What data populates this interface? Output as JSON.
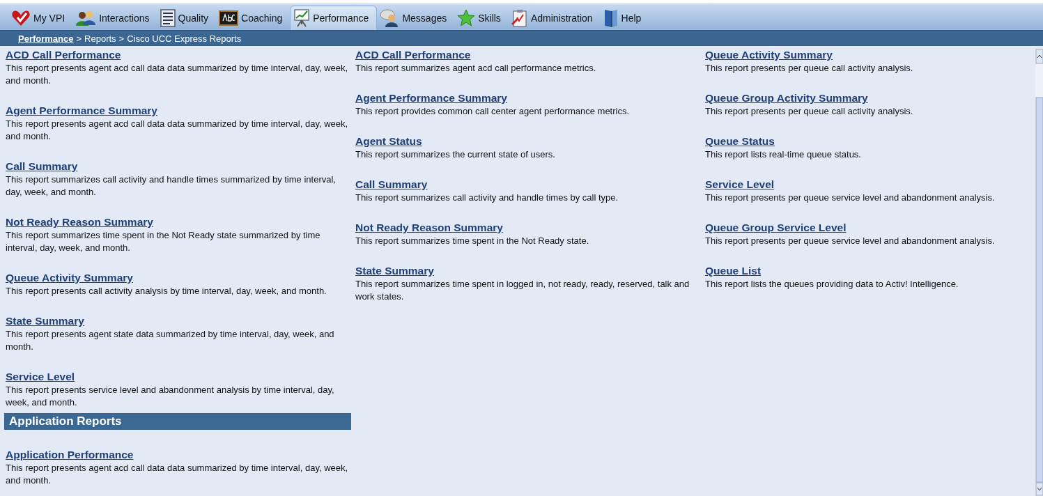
{
  "tabs": [
    {
      "label": "My VPI",
      "selected": false
    },
    {
      "label": "Interactions",
      "selected": false
    },
    {
      "label": "Quality",
      "selected": false
    },
    {
      "label": "Coaching",
      "selected": false
    },
    {
      "label": "Performance",
      "selected": true
    },
    {
      "label": "Messages",
      "selected": false
    },
    {
      "label": "Skills",
      "selected": false
    },
    {
      "label": "Administration",
      "selected": false
    },
    {
      "label": "Help",
      "selected": false
    }
  ],
  "breadcrumb": [
    {
      "kind": "link",
      "label": "Performance"
    },
    {
      "kind": "separator",
      "label": ">"
    },
    {
      "kind": "text",
      "label": "Reports"
    },
    {
      "kind": "separator",
      "label": ">"
    },
    {
      "kind": "text",
      "label": "Cisco UCC Express Reports"
    }
  ],
  "columns": [
    {
      "sections": [
        {
          "reports": [
            {
              "title": "ACD Call Performance",
              "description": "This report presents agent acd call data data summarized by time interval, day, week, and month."
            },
            {
              "title": "Agent Performance Summary",
              "description": "This report presents agent acd call data data summarized by time interval, day, week, and month."
            },
            {
              "title": "Call Summary",
              "description": "This report summarizes call activity and handle times summarized by time interval, day, week, and month."
            },
            {
              "title": "Not Ready Reason Summary",
              "description": "This report summarizes time spent in the Not Ready state summarized by time interval, day, week, and month."
            },
            {
              "title": "Queue Activity Summary",
              "description": "This report presents call activity analysis by time interval, day, week, and month."
            },
            {
              "title": "State Summary",
              "description": "This report presents agent state data summarized by time interval, day, week, and month."
            },
            {
              "title": "Service Level",
              "description": "This report presents service level and abandonment analysis by time interval, day, week, and month."
            }
          ]
        },
        {
          "heading": "Application Reports",
          "reports": [
            {
              "title": "Application Performance",
              "description": "This report presents agent acd call data data summarized by time interval, day, week, and month."
            }
          ]
        }
      ]
    },
    {
      "sections": [
        {
          "reports": [
            {
              "title": "ACD Call Performance",
              "description": "This report summarizes agent acd call performance metrics."
            },
            {
              "title": "Agent Performance Summary",
              "description": "This report provides common call center agent performance metrics."
            },
            {
              "title": "Agent Status",
              "description": "This report summarizes the current state of users."
            },
            {
              "title": "Call Summary",
              "description": "This report summarizes call activity and handle times by call type."
            },
            {
              "title": "Not Ready Reason Summary",
              "description": "This report summarizes time spent in the Not Ready state."
            },
            {
              "title": "State Summary",
              "description": "This report summarizes time spent in logged in, not ready, ready, reserved, talk and work states."
            }
          ]
        }
      ]
    },
    {
      "sections": [
        {
          "reports": [
            {
              "title": "Queue Activity Summary",
              "description": "This report presents per queue call activity analysis."
            },
            {
              "title": "Queue Group Activity Summary",
              "description": "This report presents per queue call activity analysis."
            },
            {
              "title": "Queue Status",
              "description": "This report lists real-time queue status."
            },
            {
              "title": "Service Level",
              "description": "This report presents per queue service level and abandonment analysis."
            },
            {
              "title": "Queue Group Service Level",
              "description": "This report presents per queue service level and abandonment analysis."
            },
            {
              "title": "Queue List",
              "description": "This report lists the queues providing data to Activ! Intelligence."
            }
          ]
        }
      ]
    }
  ]
}
